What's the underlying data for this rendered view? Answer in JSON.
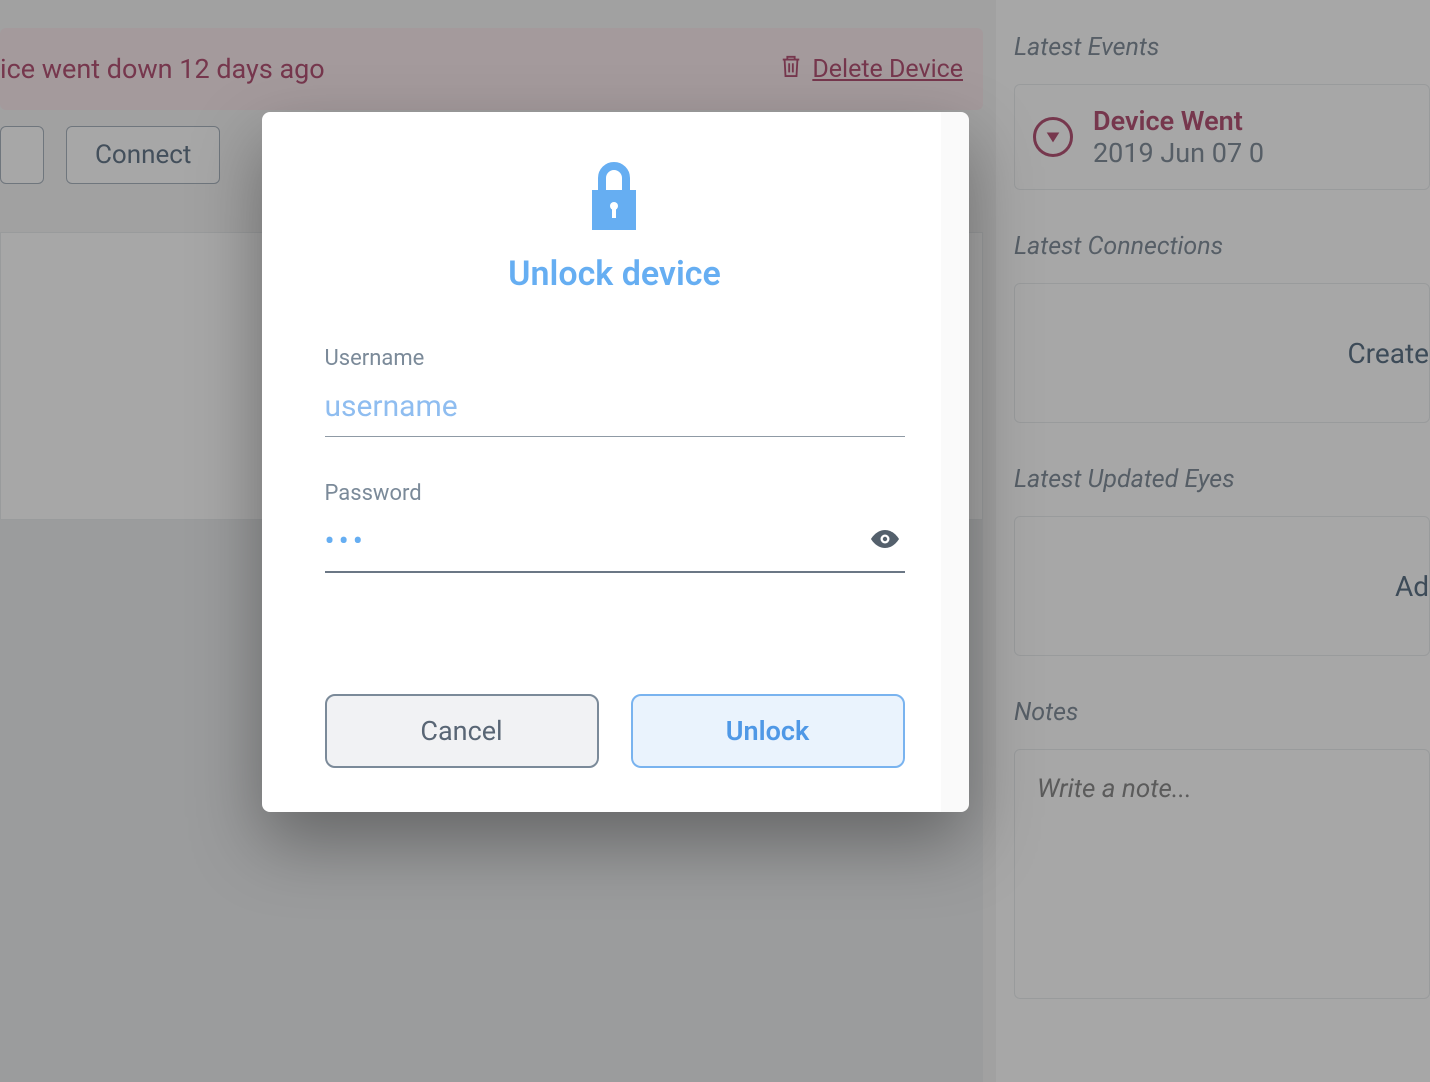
{
  "alert": {
    "message": "ice went down 12 days ago",
    "delete_label": "Delete Device"
  },
  "toolbar": {
    "connect_label": "Connect"
  },
  "sidebar": {
    "events_heading": "Latest Events",
    "event": {
      "title": "Device Went",
      "date": "2019 Jun 07 0"
    },
    "connections_heading": "Latest Connections",
    "connections_link": "Create",
    "eyes_heading": "Latest Updated Eyes",
    "eyes_link": "Ad",
    "notes_heading": "Notes",
    "notes_placeholder": "Write a note..."
  },
  "modal": {
    "title": "Unlock device",
    "username_label": "Username",
    "username_placeholder": "username",
    "username_value": "",
    "password_label": "Password",
    "password_masked": "•••",
    "cancel_label": "Cancel",
    "unlock_label": "Unlock"
  }
}
